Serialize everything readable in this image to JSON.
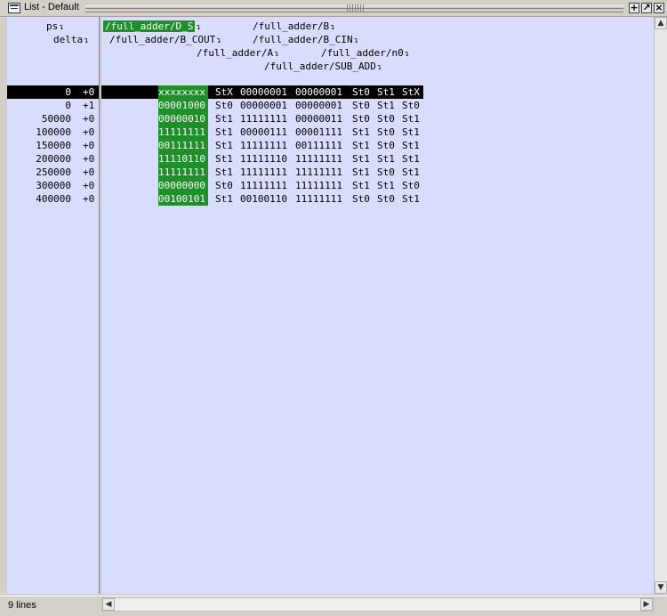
{
  "window": {
    "title": "List - Default"
  },
  "signal_names": {
    "ps": "ps",
    "delta": "delta",
    "d_s": "/full_adder/D_S",
    "b": "/full_adder/B",
    "b_cout": "/full_adder/B_COUT",
    "b_cin": "/full_adder/B_CIN",
    "a": "/full_adder/A",
    "n0": "/full_adder/n0",
    "sub_add": "/full_adder/SUB_ADD"
  },
  "rows": [
    {
      "ps": "0",
      "delta": "+0",
      "d_s": "xxxxxxxx",
      "b_cout": "StX",
      "b": "00000001",
      "a": "00000001",
      "b_cin": "St0",
      "n0": "St1",
      "sub_add": "StX"
    },
    {
      "ps": "0",
      "delta": "+1",
      "d_s": "00001000",
      "b_cout": "St0",
      "b": "00000001",
      "a": "00000001",
      "b_cin": "St0",
      "n0": "St1",
      "sub_add": "St0"
    },
    {
      "ps": "50000",
      "delta": "+0",
      "d_s": "00000010",
      "b_cout": "St1",
      "b": "11111111",
      "a": "00000011",
      "b_cin": "St0",
      "n0": "St0",
      "sub_add": "St1"
    },
    {
      "ps": "100000",
      "delta": "+0",
      "d_s": "11111111",
      "b_cout": "St1",
      "b": "00000111",
      "a": "00001111",
      "b_cin": "St1",
      "n0": "St0",
      "sub_add": "St1"
    },
    {
      "ps": "150000",
      "delta": "+0",
      "d_s": "00111111",
      "b_cout": "St1",
      "b": "11111111",
      "a": "00111111",
      "b_cin": "St1",
      "n0": "St0",
      "sub_add": "St1"
    },
    {
      "ps": "200000",
      "delta": "+0",
      "d_s": "11110110",
      "b_cout": "St1",
      "b": "11111110",
      "a": "11111111",
      "b_cin": "St1",
      "n0": "St1",
      "sub_add": "St1"
    },
    {
      "ps": "250000",
      "delta": "+0",
      "d_s": "11111111",
      "b_cout": "St1",
      "b": "11111111",
      "a": "11111111",
      "b_cin": "St1",
      "n0": "St0",
      "sub_add": "St1"
    },
    {
      "ps": "300000",
      "delta": "+0",
      "d_s": "00000000",
      "b_cout": "St0",
      "b": "11111111",
      "a": "11111111",
      "b_cin": "St1",
      "n0": "St1",
      "sub_add": "St0"
    },
    {
      "ps": "400000",
      "delta": "+0",
      "d_s": "00100101",
      "b_cout": "St1",
      "b": "00100110",
      "a": "11111111",
      "b_cin": "St0",
      "n0": "St0",
      "sub_add": "St1"
    }
  ],
  "status": {
    "lines": "9 lines"
  },
  "icons": {
    "window": "list-window-icon",
    "dock": "dock-icon",
    "undock": "undock-icon",
    "close": "close-icon"
  },
  "colors": {
    "pane_bg": "#d9ddfd",
    "highlight": "#1f8f2a",
    "cursor_row": "#000000"
  }
}
